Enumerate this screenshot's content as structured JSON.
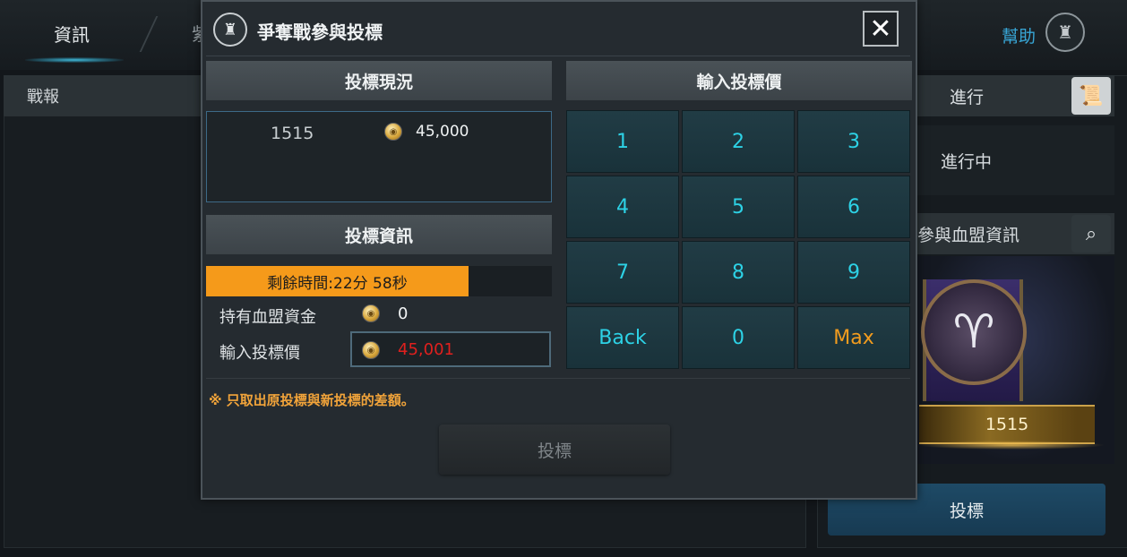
{
  "background": {
    "tab_info_label": "資訊",
    "tab_partial_label": "紫",
    "help_label": "幫助",
    "left_header": "戰報",
    "right_header": "進行",
    "status_text": "進行中",
    "guild_header": "參與血盟資訊",
    "guild_name": "1515",
    "bid_button": "投標"
  },
  "dialog": {
    "title": "爭奪戰參與投標",
    "close_glyph": "✕",
    "status_section": {
      "title": "投標現況",
      "entries": [
        {
          "name": "1515",
          "amount": "45,000"
        }
      ]
    },
    "info_section": {
      "title": "投標資訊",
      "time_remaining": "剩餘時間:22分 58秒",
      "time_remaining_fraction": 0.76,
      "funds_label": "持有血盟資金",
      "funds_value": "0",
      "bid_label": "輸入投標價",
      "bid_value": "45,001"
    },
    "input_section": {
      "title": "輸入投標價",
      "keys": [
        "1",
        "2",
        "3",
        "4",
        "5",
        "6",
        "7",
        "8",
        "9",
        "Back",
        "0",
        "Max"
      ]
    },
    "note": "※ 只取出原投標與新投標的差額。",
    "submit_label": "投標"
  },
  "colors": {
    "timer_fill": "#f59a1a",
    "keypad_digit": "#2dd2e6",
    "max_key": "#f29c1e",
    "bid_value": "#e0201e",
    "note": "#f2a43a",
    "help_link": "#38a6d6"
  },
  "icons": {
    "dialog_icon": "castle-icon",
    "close": "close-icon",
    "coin": "coin-icon",
    "help": "castle-help-icon",
    "search": "search-icon",
    "scroll": "scroll-icon",
    "emblem": "ram-emblem-icon"
  }
}
